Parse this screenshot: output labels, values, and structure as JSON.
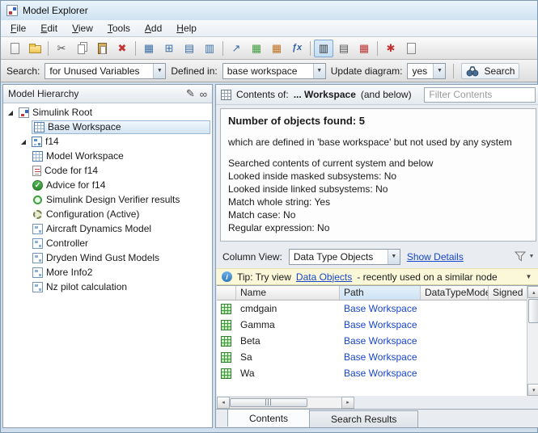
{
  "window": {
    "title": "Model Explorer"
  },
  "menubar": {
    "items": [
      "File",
      "Edit",
      "View",
      "Tools",
      "Add",
      "Help"
    ]
  },
  "toolbar": {
    "icon_names": [
      "new-model",
      "open-model",
      "cut",
      "copy",
      "paste",
      "delete",
      "add-block",
      "add-parameter",
      "add-signal",
      "add-state",
      "launch-editor",
      "add-chart",
      "add-data",
      "add-function",
      "column-view-toggle",
      "dialog-view",
      "compare-views",
      "options",
      "help-doc"
    ]
  },
  "searchbar": {
    "search_label": "Search:",
    "search_value": "for Unused Variables",
    "defined_in_label": "Defined in:",
    "defined_in_value": "base workspace",
    "update_diagram_label": "Update diagram:",
    "update_diagram_value": "yes",
    "search_button_label": "Search"
  },
  "hierarchy": {
    "title": "Model Hierarchy",
    "tree": [
      {
        "label": "Simulink Root",
        "level": 0,
        "expanded": true,
        "icon": "simulink-root"
      },
      {
        "label": "Base Workspace",
        "level": 1,
        "selected": true,
        "icon": "workspace"
      },
      {
        "label": "f14",
        "level": 1,
        "expanded": true,
        "icon": "model"
      },
      {
        "label": "Model Workspace",
        "level": 2,
        "icon": "workspace"
      },
      {
        "label": "Code for f14",
        "level": 2,
        "icon": "code"
      },
      {
        "label": "Advice for f14",
        "level": 2,
        "icon": "advice"
      },
      {
        "label": "Simulink Design Verifier results",
        "level": 2,
        "icon": "verifier"
      },
      {
        "label": "Configuration (Active)",
        "level": 2,
        "icon": "configuration"
      },
      {
        "label": "Aircraft Dynamics Model",
        "level": 2,
        "icon": "subsystem"
      },
      {
        "label": "Controller",
        "level": 2,
        "icon": "subsystem"
      },
      {
        "label": "Dryden Wind Gust Models",
        "level": 2,
        "icon": "subsystem"
      },
      {
        "label": "More Info2",
        "level": 2,
        "icon": "subsystem"
      },
      {
        "label": "Nz pilot calculation",
        "level": 2,
        "icon": "subsystem"
      }
    ]
  },
  "contents": {
    "header_label": "Contents of:",
    "header_target": "... Workspace",
    "header_suffix": "(and below)",
    "filter_placeholder": "Filter Contents",
    "summary": {
      "title": "Number of objects found: 5",
      "line1": "which are defined in 'base workspace' but not used by any system",
      "line2": "Searched contents of current system and below",
      "line3": "Looked inside masked subsystems: No",
      "line4": "Looked inside linked subsystems: No",
      "line5": "Match whole string: Yes",
      "line6": "Match case: No",
      "line7": "Regular expression: No"
    },
    "column_view": {
      "label": "Column View:",
      "value": "Data Type Objects",
      "details_link": "Show Details"
    },
    "tip": {
      "prefix": "Tip: Try view",
      "link": "Data Objects",
      "suffix": "- recently used on a similar node"
    },
    "table": {
      "headers": [
        "Name",
        "Path",
        "DataTypeMode",
        "Signed"
      ],
      "rows": [
        {
          "name": "cmdgain",
          "path": "Base Workspace"
        },
        {
          "name": "Gamma",
          "path": "Base Workspace"
        },
        {
          "name": "Beta",
          "path": "Base Workspace"
        },
        {
          "name": "Sa",
          "path": "Base Workspace"
        },
        {
          "name": "Wa",
          "path": "Base Workspace"
        }
      ]
    },
    "tabs": [
      {
        "label": "Contents",
        "active": true
      },
      {
        "label": "Search Results",
        "active": false
      }
    ]
  },
  "glyphs": {
    "cut": "✂",
    "delete": "✖",
    "grid": "▦",
    "grid_plus": "⊞",
    "grid_rows": "▤",
    "grid_cols": "▥",
    "launch": "↗",
    "fx": "ƒx",
    "star": "✱",
    "expander": "◢",
    "combo": "▼",
    "pencil": "✎",
    "glasses": "∞",
    "info": "i",
    "check": "✓",
    "up": "▴",
    "down": "▾",
    "left": "◂",
    "right": "▸"
  }
}
